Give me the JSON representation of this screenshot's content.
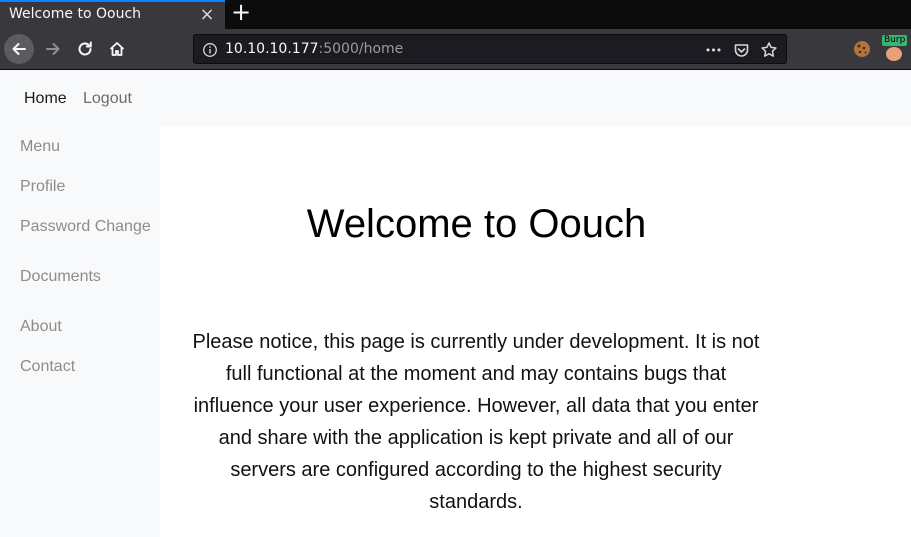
{
  "browser": {
    "tab_title": "Welcome to Oouch",
    "tab_close_glyph": "×",
    "new_tab_glyph": "+",
    "url_host": "10.10.10.177",
    "url_rest": ":5000/home",
    "more_glyph": "•••",
    "extensions": {
      "burp_label": "Burp"
    }
  },
  "topnav": {
    "home": "Home",
    "logout": "Logout"
  },
  "sidebar": {
    "items": [
      {
        "label": "Menu"
      },
      {
        "label": "Profile"
      },
      {
        "label": "Password Change"
      },
      {
        "label": "Documents"
      },
      {
        "label": "About"
      },
      {
        "label": "Contact"
      }
    ]
  },
  "main": {
    "title": "Welcome to Oouch",
    "notice": "Please notice, this page is currently under development. It is not full functional at the moment and may contains bugs that influence your user experience. However, all data that you enter and share with the application is kept private and all of our servers are configured according to the highest security standards."
  },
  "colors": {
    "chrome_dark": "#0c0c0d",
    "chrome_toolbar": "#38383d",
    "tab_accent": "#0a84ff",
    "page_nav_bg": "#f8f9fa",
    "link_muted": "#8c8c8c"
  }
}
